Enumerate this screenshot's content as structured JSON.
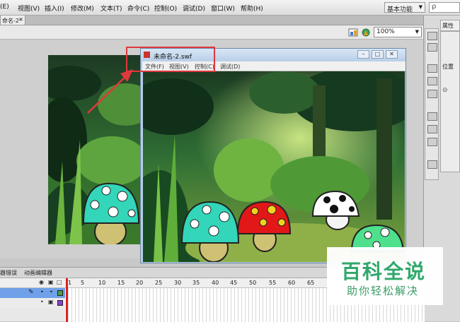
{
  "menu": {
    "items": [
      "(E)",
      "视图(V)",
      "插入(I)",
      "修改(M)",
      "文本(T)",
      "命令(C)",
      "控制(O)",
      "调试(D)",
      "窗口(W)",
      "帮助(H)"
    ],
    "workspace": "基本功能",
    "search_placeholder": "ρ"
  },
  "document": {
    "tab_label": "命名-2*",
    "tab_close": "✕"
  },
  "editbar": {
    "zoom": "100%"
  },
  "right_panel": {
    "tab_label": "属性",
    "position_label": "位置"
  },
  "swf_window": {
    "title": "未命名-2.swf",
    "controls": {
      "minimize": "–",
      "maximize": "□",
      "close": "✕"
    },
    "menu": [
      "文件(F)",
      "视图(V)",
      "控制(C)",
      "调试(D)"
    ]
  },
  "timeline": {
    "tabs": [
      "器错误",
      "动画编辑器"
    ],
    "frame_numbers": [
      "1",
      "5",
      "10",
      "15",
      "20",
      "25",
      "30",
      "35",
      "40",
      "45",
      "50",
      "55",
      "60",
      "65"
    ]
  },
  "watermark": {
    "title": "百科全说",
    "subtitle": "助你轻松解决"
  },
  "colors": {
    "annotation": "#e0383c",
    "brand_green": "#2fa86b",
    "playhead": "#d22222"
  }
}
